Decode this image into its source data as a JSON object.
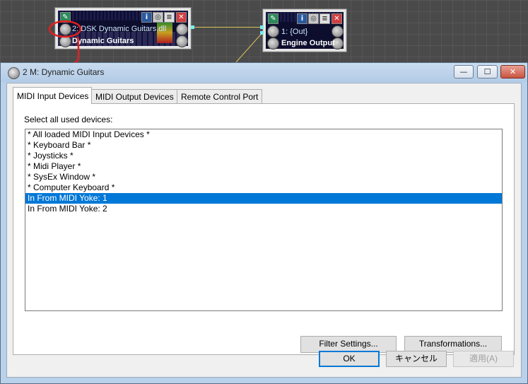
{
  "canvas": {
    "module_guitars": {
      "title": "2: DSK Dynamic Guitars.dll",
      "name": "Dynamic Guitars"
    },
    "module_output": {
      "title": "1: {Out}",
      "name": "Engine Output"
    },
    "colors": {
      "cable": "#d6c25a",
      "annotation": "#e02020"
    }
  },
  "dialog": {
    "title": "2 M: Dynamic Guitars",
    "window_buttons": {
      "minimize": "—",
      "maximize": "☐",
      "close": "✕"
    },
    "tabs": [
      {
        "label": "MIDI Input Devices",
        "active": true
      },
      {
        "label": "MIDI Output Devices",
        "active": false
      },
      {
        "label": "Remote Control Port",
        "active": false
      }
    ],
    "prompt": "Select all used devices:",
    "devices": [
      {
        "label": "* All loaded MIDI Input Devices *",
        "selected": false
      },
      {
        "label": "* Keyboard Bar *",
        "selected": false
      },
      {
        "label": "* Joysticks *",
        "selected": false
      },
      {
        "label": "* Midi Player *",
        "selected": false
      },
      {
        "label": "* SysEx Window *",
        "selected": false
      },
      {
        "label": "* Computer Keyboard *",
        "selected": false
      },
      {
        "label": "In From MIDI Yoke:  1",
        "selected": true
      },
      {
        "label": "In From MIDI Yoke:  2",
        "selected": false
      }
    ],
    "buttons": {
      "filter_settings": "Filter Settings...",
      "transformations": "Transformations...",
      "ok": "OK",
      "cancel": "キャンセル",
      "apply": "適用(A)"
    },
    "colors": {
      "selection": "#0078d7",
      "titlebar": "#b9d1ea"
    }
  }
}
